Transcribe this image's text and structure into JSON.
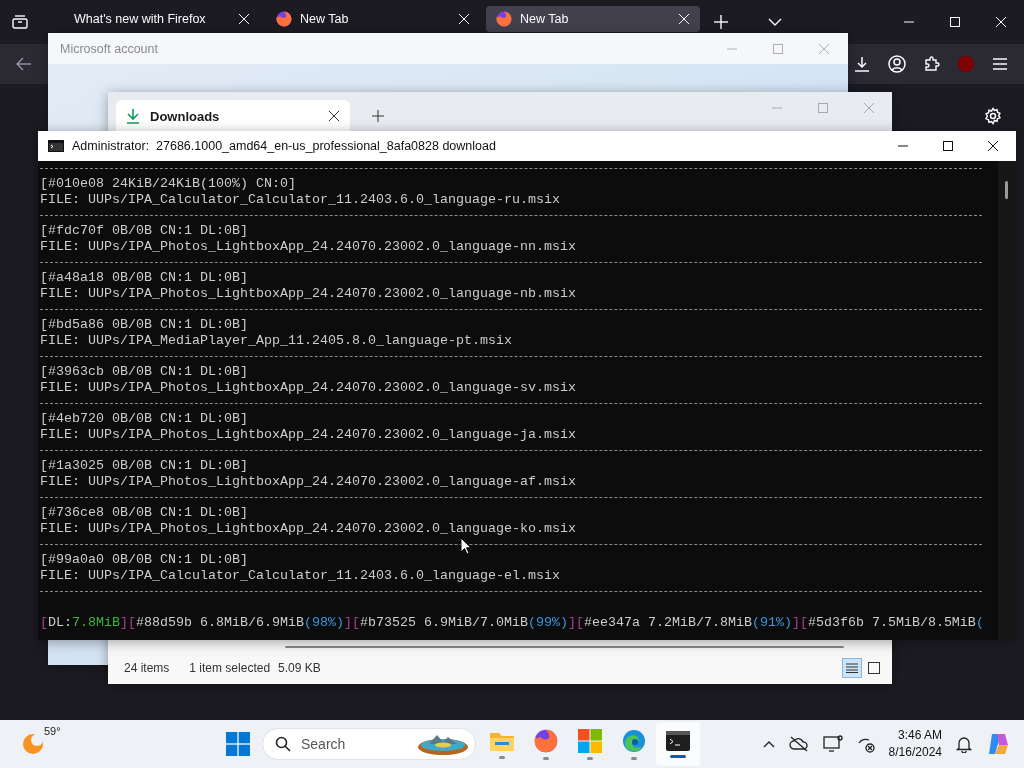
{
  "firefox": {
    "tabs": [
      {
        "title": "What's new with Firefox",
        "selected": false,
        "kind": "plain"
      },
      {
        "title": "New Tab",
        "selected": false,
        "kind": "firefox"
      },
      {
        "title": "New Tab",
        "selected": true,
        "kind": "firefox"
      }
    ]
  },
  "account_window": {
    "title": "Microsoft account"
  },
  "explorer": {
    "tab": "Downloads",
    "status_bar": {
      "items": "24 items",
      "selection": "1 item selected",
      "size": "5.09 KB"
    },
    "views": [
      {
        "kind": "details",
        "selected": true
      },
      {
        "kind": "tiles",
        "selected": false
      }
    ]
  },
  "console": {
    "title": "Administrator:  27686.1000_amd64_en-us_professional_8afa0828 download",
    "entries": [
      {
        "header": "[#010e08 24KiB/24KiB(100%) CN:0]",
        "file": "FILE: UUPs/IPA_Calculator_Calculator_11.2403.6.0_language-ru.msix"
      },
      {
        "header": "[#fdc70f 0B/0B CN:1 DL:0B]",
        "file": "FILE: UUPs/IPA_Photos_LightboxApp_24.24070.23002.0_language-nn.msix"
      },
      {
        "header": "[#a48a18 0B/0B CN:1 DL:0B]",
        "file": "FILE: UUPs/IPA_Photos_LightboxApp_24.24070.23002.0_language-nb.msix"
      },
      {
        "header": "[#bd5a86 0B/0B CN:1 DL:0B]",
        "file": "FILE: UUPs/IPA_MediaPlayer_App_11.2405.8.0_language-pt.msix"
      },
      {
        "header": "[#3963cb 0B/0B CN:1 DL:0B]",
        "file": "FILE: UUPs/IPA_Photos_LightboxApp_24.24070.23002.0_language-sv.msix"
      },
      {
        "header": "[#4eb720 0B/0B CN:1 DL:0B]",
        "file": "FILE: UUPs/IPA_Photos_LightboxApp_24.24070.23002.0_language-ja.msix"
      },
      {
        "header": "[#1a3025 0B/0B CN:1 DL:0B]",
        "file": "FILE: UUPs/IPA_Photos_LightboxApp_24.24070.23002.0_language-af.msix"
      },
      {
        "header": "[#736ce8 0B/0B CN:1 DL:0B]",
        "file": "FILE: UUPs/IPA_Photos_LightboxApp_24.24070.23002.0_language-ko.msix"
      },
      {
        "header": "[#99a0a0 0B/0B CN:1 DL:0B]",
        "file": "FILE: UUPs/IPA_Calculator_Calculator_11.2403.6.0_language-el.msix"
      }
    ],
    "status_line": [
      {
        "text": "[",
        "kind": "bracket"
      },
      {
        "text": "DL:",
        "kind": "plain"
      },
      {
        "text": "7.8MiB",
        "kind": "speed"
      },
      {
        "text": "][",
        "kind": "bracket"
      },
      {
        "text": "#88d59b 6.8MiB/6.9MiB",
        "kind": "plain"
      },
      {
        "text": "(98%)",
        "kind": "percent"
      },
      {
        "text": "][",
        "kind": "bracket"
      },
      {
        "text": "#b73525 6.9MiB/7.0MiB",
        "kind": "plain"
      },
      {
        "text": "(99%)",
        "kind": "percent"
      },
      {
        "text": "][",
        "kind": "bracket"
      },
      {
        "text": "#ee347a 7.2MiB/7.8MiB",
        "kind": "plain"
      },
      {
        "text": "(91%)",
        "kind": "percent"
      },
      {
        "text": "][",
        "kind": "bracket"
      },
      {
        "text": "#5d3f6b 7.5MiB/8.5MiB",
        "kind": "plain"
      },
      {
        "text": "(",
        "kind": "percent"
      }
    ]
  },
  "taskbar": {
    "weather": "59°",
    "search": {
      "placeholder": "Search"
    },
    "apps": [
      {
        "kind": "explorer",
        "active": false
      },
      {
        "kind": "firefox",
        "active": false
      },
      {
        "kind": "store",
        "active": false
      },
      {
        "kind": "edge",
        "active": false
      },
      {
        "kind": "terminal",
        "active": true
      }
    ],
    "clock": {
      "time": "3:46 AM",
      "date": "8/16/2024"
    }
  }
}
